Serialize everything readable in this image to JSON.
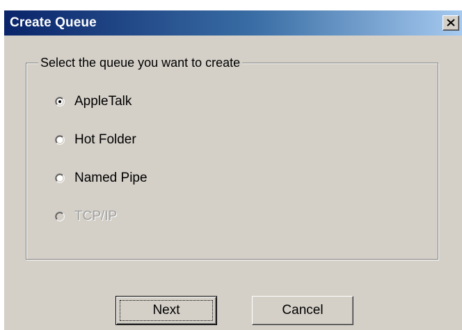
{
  "window": {
    "title": "Create Queue",
    "close_icon": "close-icon"
  },
  "group": {
    "legend": "Select the queue you want to create"
  },
  "options": [
    {
      "label": "AppleTalk",
      "selected": true,
      "enabled": true
    },
    {
      "label": "Hot Folder",
      "selected": false,
      "enabled": true
    },
    {
      "label": "Named Pipe",
      "selected": false,
      "enabled": true
    },
    {
      "label": "TCP/IP",
      "selected": false,
      "enabled": false
    }
  ],
  "buttons": {
    "next_label": "Next",
    "cancel_label": "Cancel"
  },
  "colors": {
    "titlebar_start": "#0a246a",
    "titlebar_end": "#a6caf0",
    "dialog_face": "#d4d0c8"
  }
}
